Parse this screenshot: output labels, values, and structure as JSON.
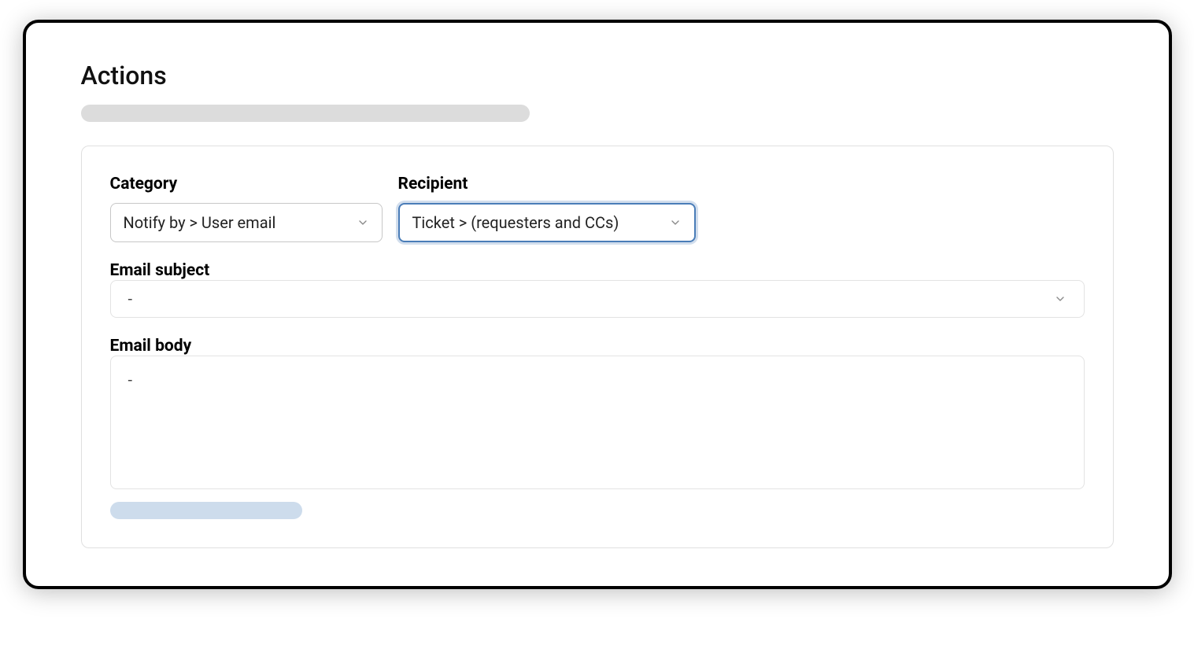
{
  "header": {
    "title": "Actions"
  },
  "form": {
    "category": {
      "label": "Category",
      "value": "Notify by > User email"
    },
    "recipient": {
      "label": "Recipient",
      "value": "Ticket > (requesters and CCs)"
    },
    "email_subject": {
      "label": "Email subject",
      "value": "-"
    },
    "email_body": {
      "label": "Email body",
      "value": "-"
    }
  }
}
